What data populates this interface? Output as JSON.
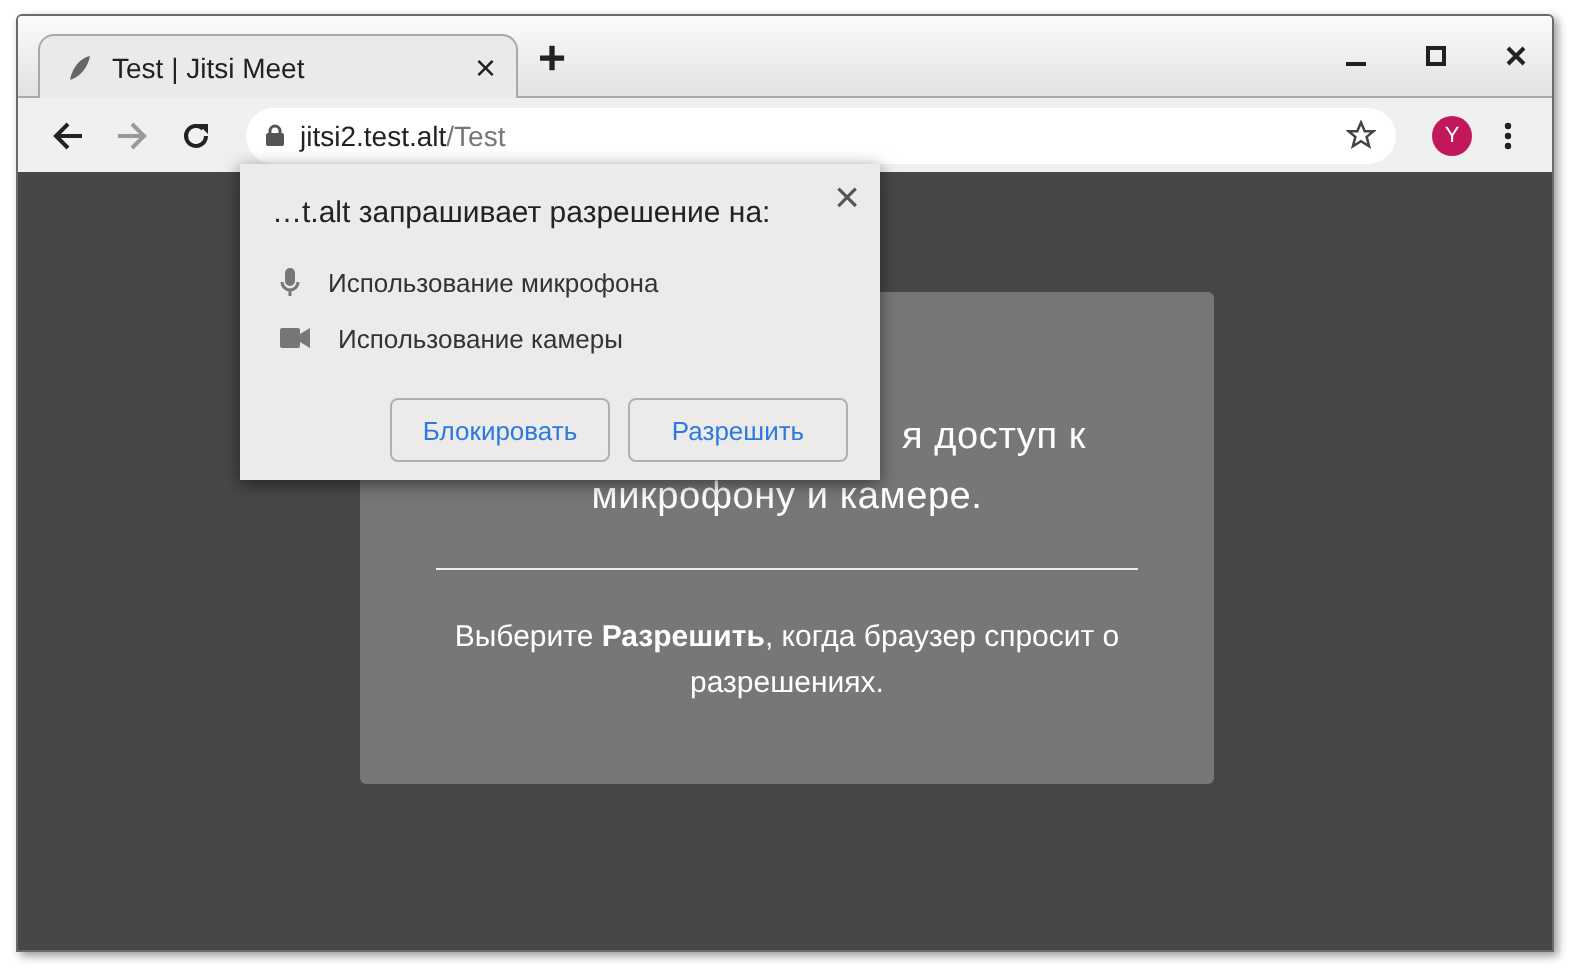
{
  "tabs": [
    {
      "title": "Test | Jitsi Meet",
      "selected": true,
      "close": "×"
    }
  ],
  "new_tab": "+",
  "toolbar": {
    "back_enabled": true,
    "forward_enabled": false,
    "url_host": "jitsi2.test.alt",
    "url_path": "/Test",
    "bookmarked": false,
    "profile_initial": "Y"
  },
  "card": {
    "heading_lines": [
      "я доступ к",
      "микрофону и камере."
    ],
    "text": "Выберите **Разрешить**, когда браузер спросит о разрешениях."
  },
  "permission_popup": {
    "title": "…t.alt запрашивает разрешение на:",
    "close": "×",
    "items": [
      {
        "kind": "microphone",
        "label": "Использование микрофона"
      },
      {
        "kind": "camera",
        "label": "Использование камеры"
      }
    ],
    "buttons": [
      "Блокировать",
      "Разрешить"
    ]
  }
}
